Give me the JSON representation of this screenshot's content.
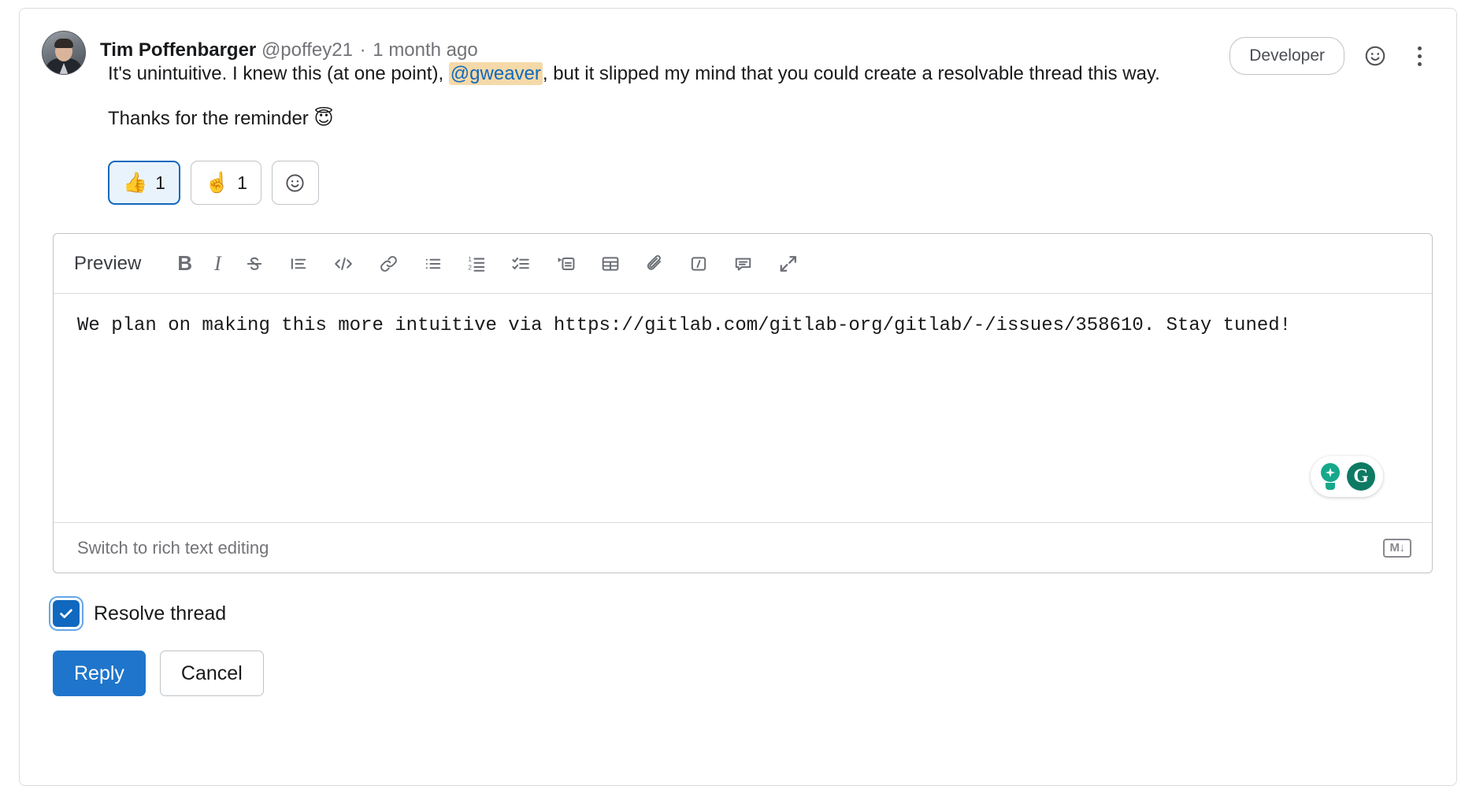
{
  "note": {
    "author_name": "Tim Poffenbarger",
    "author_handle": "@poffey21",
    "separator": "·",
    "timestamp": "1 month ago",
    "role_badge": "Developer",
    "paragraph_1_before": "It's unintuitive. I knew this (at one point), ",
    "mention": "@gweaver",
    "paragraph_1_after": ", but it slipped my mind that you could create a resolvable thread this way.",
    "paragraph_2": "Thanks for the reminder ",
    "paragraph_2_emoji": "😇",
    "emoji_button_icon": "smiley-icon",
    "more_actions_icon": "kebab-menu-icon"
  },
  "reactions": [
    {
      "emoji": "👍",
      "count": "1",
      "name": "thumbs-up",
      "active": true
    },
    {
      "emoji": "☝️",
      "count": "1",
      "name": "point-up",
      "active": false
    }
  ],
  "add_reaction": {
    "icon": "add-reaction-smiley-icon"
  },
  "editor": {
    "preview_label": "Preview",
    "toolbar": [
      {
        "name": "bold-icon",
        "label": "B"
      },
      {
        "name": "italic-icon",
        "label": "I"
      },
      {
        "name": "strikethrough-icon",
        "label": "S"
      },
      {
        "name": "blockquote-icon",
        "label": ""
      },
      {
        "name": "code-icon",
        "label": "</>"
      },
      {
        "name": "link-icon",
        "label": ""
      },
      {
        "name": "bullet-list-icon",
        "label": ""
      },
      {
        "name": "numbered-list-icon",
        "label": ""
      },
      {
        "name": "checklist-icon",
        "label": ""
      },
      {
        "name": "collapsible-section-icon",
        "label": ""
      },
      {
        "name": "table-icon",
        "label": ""
      },
      {
        "name": "attach-file-icon",
        "label": ""
      },
      {
        "name": "quick-actions-slash-icon",
        "label": "/"
      },
      {
        "name": "comment-template-icon",
        "label": ""
      },
      {
        "name": "fullscreen-expand-icon",
        "label": ""
      }
    ],
    "textarea_value": "We plan on making this more intuitive via https://gitlab.com/gitlab-org/gitlab/-/issues/358610. Stay tuned!",
    "switch_link": "Switch to rich text editing",
    "markdown_badge": "M",
    "grammarly": {
      "assistant_icon": "grammarly-lightbulb-icon",
      "logo_letter": "G"
    }
  },
  "resolve": {
    "label": "Resolve thread",
    "checked": true
  },
  "buttons": {
    "reply": "Reply",
    "cancel": "Cancel"
  },
  "colors": {
    "primary_blue": "#1f75cb",
    "link_blue": "#1068bf",
    "mention_bg": "#f5d9a8",
    "grammarly_green": "#0e7a63"
  }
}
